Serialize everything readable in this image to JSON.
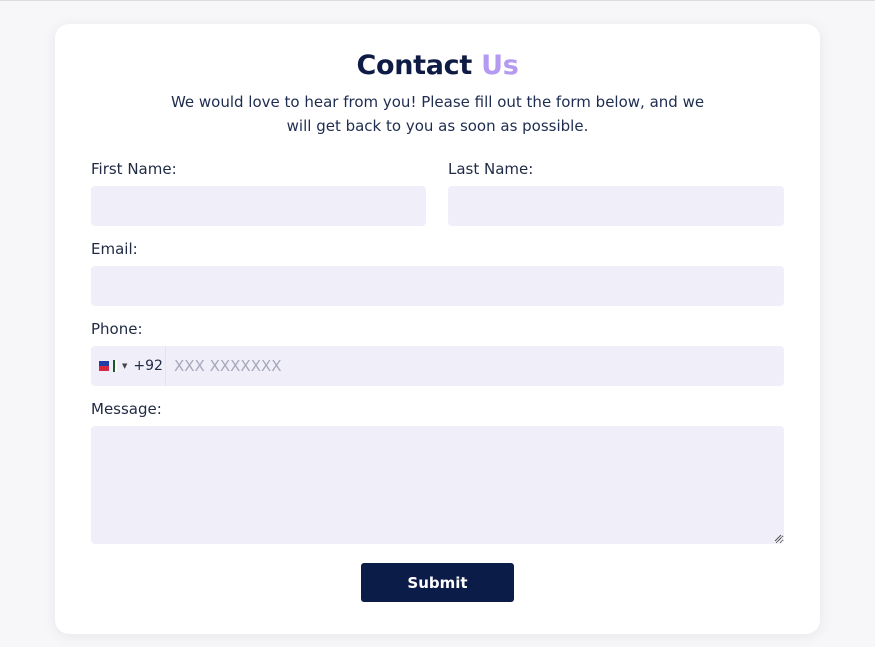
{
  "header": {
    "title_main": "Contact",
    "title_accent": "Us",
    "subtitle": "We would love to hear from you! Please fill out the form below, and we will get back to you as soon as possible."
  },
  "form": {
    "first_name_label": "First Name:",
    "last_name_label": "Last Name:",
    "email_label": "Email:",
    "phone_label": "Phone:",
    "phone_dial_code": "+92",
    "phone_placeholder": "XXX XXXXXXX",
    "message_label": "Message:",
    "submit_label": "Submit"
  },
  "colors": {
    "accent": "#b49af0",
    "primary": "#0c1c48",
    "field_bg": "#f0eff9"
  }
}
